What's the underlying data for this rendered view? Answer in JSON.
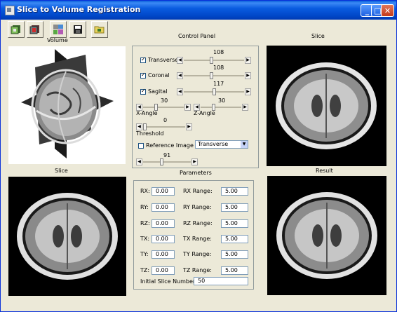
{
  "window": {
    "title": "Slice to Volume Registration"
  },
  "title_buttons": {
    "minimize": "_",
    "maximize": "□",
    "close": "✕"
  },
  "toolbar": {
    "icons": [
      "cube-open-icon",
      "cube-stop-icon",
      "load-images-icon",
      "save-icon",
      "folder-icon"
    ],
    "volume_label": "Volume"
  },
  "control_panel": {
    "title": "Control Panel",
    "transverse": {
      "label": "Transverse",
      "checked": true,
      "value": "108",
      "fraction": 0.46
    },
    "coronal": {
      "label": "Coronal",
      "checked": true,
      "value": "108",
      "fraction": 0.46
    },
    "sagittal": {
      "label": "Sagital",
      "checked": true,
      "value": "117",
      "fraction": 0.5
    },
    "x_angle": {
      "label": "X-Angle",
      "value": "30",
      "fraction": 0.3
    },
    "z_angle": {
      "label": "Z-Angle",
      "value": "30",
      "fraction": 0.3
    },
    "threshold": {
      "label": "Threshold",
      "value": "0",
      "fraction": 0.0
    },
    "reference_image": {
      "label": "Reference Image",
      "checked": false,
      "select_value": "Transverse"
    },
    "bottom_slider": {
      "value": "91",
      "fraction": 0.38
    }
  },
  "panels": {
    "slice_top": "Slice",
    "slice_bottom": "Slice",
    "result": "Result"
  },
  "parameters": {
    "title": "Parameters",
    "rows": [
      {
        "label": "RX:",
        "value": "0.00",
        "range_label": "RX Range:",
        "range_value": "5.00"
      },
      {
        "label": "RY:",
        "value": "0.00",
        "range_label": "RY Range:",
        "range_value": "5.00"
      },
      {
        "label": "RZ:",
        "value": "0.00",
        "range_label": "RZ Range:",
        "range_value": "5.00"
      },
      {
        "label": "TX:",
        "value": "0.00",
        "range_label": "TX Range:",
        "range_value": "5.00"
      },
      {
        "label": "TY:",
        "value": "0.00",
        "range_label": "TY Range:",
        "range_value": "5.00"
      },
      {
        "label": "TZ:",
        "value": "0.00",
        "range_label": "TZ Range:",
        "range_value": "5.00"
      }
    ],
    "initial_slice_label": "Initial Slice Number:",
    "initial_slice_value": "50"
  },
  "colors": {
    "window_bg": "#ece9d8",
    "titlebar": "#0a5ce0",
    "image_bg": "#000000"
  }
}
